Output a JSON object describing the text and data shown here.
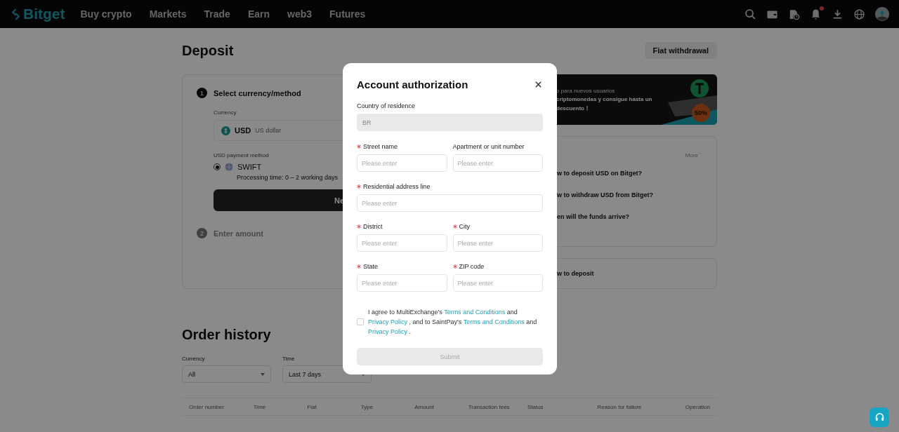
{
  "header": {
    "logo": "Bitget",
    "nav": [
      "Buy crypto",
      "Markets",
      "Trade",
      "Earn",
      "web3",
      "Futures"
    ],
    "notification_dot": true
  },
  "page": {
    "title": "Deposit",
    "fiat_withdrawal": "Fiat withdrawal",
    "steps": [
      {
        "number": "1",
        "title": "Select currency/method",
        "active": true
      },
      {
        "number": "2",
        "title": "Enter amount",
        "active": false
      }
    ],
    "currency": {
      "label": "Currency",
      "code": "USD",
      "name": "US dollar"
    },
    "payment_method": {
      "label": "USD payment method",
      "options": [
        {
          "name": "SWIFT",
          "selected": true,
          "processing": "Processing time: 0 – 2 working days"
        }
      ]
    },
    "next_button": "Ne",
    "banner": {
      "lines": [
        "o para nuevos usuarios",
        "criptomonedas y consigue hasta un",
        "descuento！"
      ],
      "badge": "50%"
    },
    "faq": {
      "more": "More",
      "items": [
        "w to deposit USD on Bitget?",
        "w to withdraw USD from Bitget?",
        "en will the funds arrive?"
      ]
    },
    "guide": "w to deposit"
  },
  "order_history": {
    "title": "Order history",
    "filters": [
      {
        "label": "Currency",
        "value": "All"
      },
      {
        "label": "Time",
        "value": "Last 7 days"
      }
    ],
    "columns": [
      "Order number",
      "Time",
      "Fiat",
      "Type",
      "Amount",
      "Transaction fees",
      "Status",
      "Reason for failure",
      "Operation"
    ]
  },
  "modal": {
    "title": "Account authorization",
    "country": {
      "label": "Country of residence",
      "value": "BR",
      "disabled": true
    },
    "fields": [
      {
        "label": "Street name",
        "required": true,
        "placeholder": "Please enter",
        "kind": "half"
      },
      {
        "label": "Apartment or unit number",
        "required": false,
        "placeholder": "Please enter",
        "kind": "half"
      },
      {
        "label": "Residential address line",
        "required": true,
        "placeholder": "Please enter",
        "kind": "full"
      },
      {
        "label": "District",
        "required": true,
        "placeholder": "Please enter",
        "kind": "half"
      },
      {
        "label": "City",
        "required": true,
        "placeholder": "Please enter",
        "kind": "half"
      },
      {
        "label": "State",
        "required": true,
        "placeholder": "Please enter",
        "kind": "half"
      },
      {
        "label": "ZIP code",
        "required": true,
        "placeholder": "Please enter",
        "kind": "half"
      }
    ],
    "agreement": {
      "checked": false,
      "parts": [
        {
          "kind": "text",
          "text": "I agree to MultiExchange's "
        },
        {
          "kind": "link",
          "text": "Terms and Conditions"
        },
        {
          "kind": "text",
          "text": " and "
        },
        {
          "kind": "link",
          "text": "Privacy Policy"
        },
        {
          "kind": "text",
          "text": " , and to SaintPay's "
        },
        {
          "kind": "link",
          "text": "Terms and Conditions"
        },
        {
          "kind": "text",
          "text": " and "
        },
        {
          "kind": "link",
          "text": "Privacy Policy"
        },
        {
          "kind": "text",
          "text": " ."
        }
      ]
    },
    "submit": {
      "label": "Submit",
      "disabled": true
    }
  }
}
